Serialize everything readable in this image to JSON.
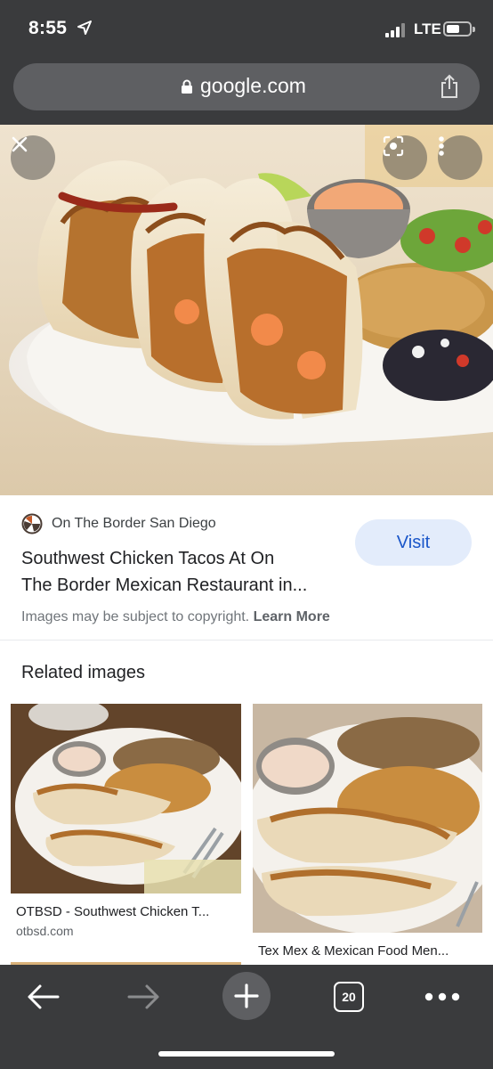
{
  "status_bar": {
    "time": "8:55",
    "network": "LTE",
    "location_icon": "location-arrow-icon",
    "signal_icon": "signal-icon",
    "battery_icon": "battery-icon"
  },
  "url_bar": {
    "url": "google.com",
    "lock_icon": "lock-icon",
    "share_icon": "share-icon"
  },
  "hero": {
    "close_icon": "close-icon",
    "lens_icon": "lens-icon",
    "more_icon": "more-vertical-icon"
  },
  "result": {
    "source": "On The Border San Diego",
    "title_line1": "Southwest Chicken Tacos At On",
    "title_line2": "The Border Mexican Restaurant in...",
    "visit_label": "Visit",
    "copyright_text": "Images may be subject to copyright.",
    "learn_more": "Learn More"
  },
  "related": {
    "heading": "Related images",
    "items": [
      {
        "caption": "OTBSD - Southwest Chicken T...",
        "site": "otbsd.com"
      },
      {
        "caption": "Tex Mex & Mexican Food Men...",
        "site": ""
      }
    ]
  },
  "toolbar": {
    "back_icon": "back-arrow-icon",
    "forward_icon": "forward-arrow-icon",
    "new_tab_icon": "plus-icon",
    "tab_count": "20",
    "menu_icon": "more-horizontal-icon"
  },
  "colors": {
    "chrome_dark": "#3a3b3d",
    "url_pill": "#5e5f62",
    "visit_bg": "#e3ecfb",
    "visit_text": "#1a56c9"
  }
}
